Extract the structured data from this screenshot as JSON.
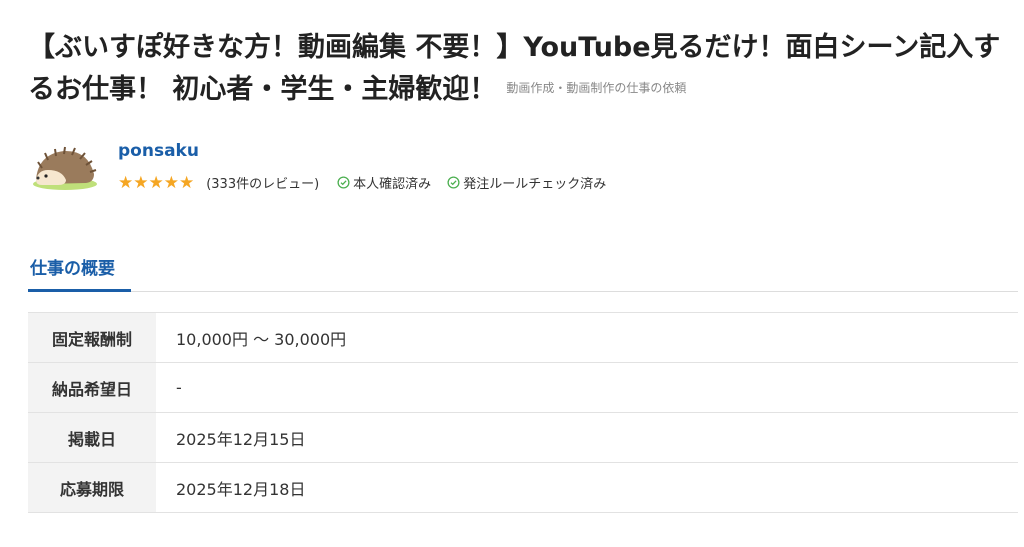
{
  "job": {
    "title": "【ぶいすぽ好きな方！動画編集 不要！】YouTube見るだけ！面白シーン記入するお仕事！ 初心者・学生・主婦歓迎！",
    "category_link": "動画作成・動画制作の仕事の依頼"
  },
  "client": {
    "avatar_icon": "hedgehog-avatar",
    "name": "ponsaku",
    "rating": 5,
    "rating_max": 5,
    "stars_text": "★★★★★",
    "review_count_text": "(333件のレビュー)",
    "badges": [
      {
        "icon": "check-circle-icon",
        "label": "本人確認済み"
      },
      {
        "icon": "check-circle-icon",
        "label": "発注ルールチェック済み"
      }
    ]
  },
  "tabs": [
    {
      "label": "仕事の概要",
      "active": true
    }
  ],
  "summary": {
    "rows": [
      {
        "label": "固定報酬制",
        "value": "10,000円 〜 30,000円"
      },
      {
        "label": "納品希望日",
        "value": "-"
      },
      {
        "label": "掲載日",
        "value": "2025年12月15日"
      },
      {
        "label": "応募期限",
        "value": "2025年12月18日"
      }
    ]
  },
  "colors": {
    "accent": "#1a5ea8",
    "star": "#f5a623",
    "badge_check": "#4caf50",
    "row_header_bg": "#f3f3f3"
  }
}
